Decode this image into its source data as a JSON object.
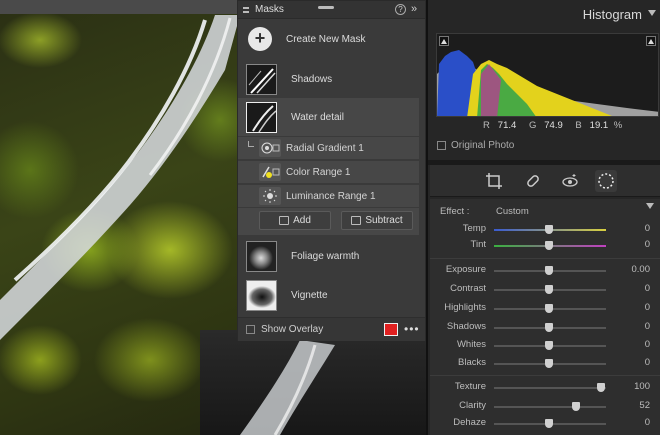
{
  "masks_panel": {
    "title": "Masks",
    "create_label": "Create New Mask",
    "masks": [
      {
        "label": "Shadows"
      },
      {
        "label": "Water detail"
      },
      {
        "label": "Foliage warmth"
      },
      {
        "label": "Vignette"
      }
    ],
    "components": [
      {
        "label": "Radial Gradient 1",
        "icon": "radial-gradient-icon"
      },
      {
        "label": "Color Range 1",
        "icon": "color-range-icon"
      },
      {
        "label": "Luminance Range 1",
        "icon": "luminance-range-icon"
      }
    ],
    "add_label": "Add",
    "subtract_label": "Subtract",
    "overlay_label": "Show Overlay",
    "overlay_color": "#e02020"
  },
  "histogram": {
    "title": "Histogram",
    "r_label": "R",
    "r_value": "71.4",
    "g_label": "G",
    "g_value": "74.9",
    "b_label": "B",
    "b_value": "19.1",
    "unit": "%",
    "original_label": "Original Photo"
  },
  "adjust": {
    "effect_label": "Effect :",
    "effect_value": "Custom",
    "sliders": [
      {
        "name": "Temp",
        "value": "0"
      },
      {
        "name": "Tint",
        "value": "0"
      },
      {
        "name": "Exposure",
        "value": "0.00"
      },
      {
        "name": "Contrast",
        "value": "0"
      },
      {
        "name": "Highlights",
        "value": "0"
      },
      {
        "name": "Shadows",
        "value": "0"
      },
      {
        "name": "Whites",
        "value": "0"
      },
      {
        "name": "Blacks",
        "value": "0"
      },
      {
        "name": "Texture",
        "value": "100"
      },
      {
        "name": "Clarity",
        "value": "52"
      },
      {
        "name": "Dehaze",
        "value": "0"
      }
    ]
  }
}
